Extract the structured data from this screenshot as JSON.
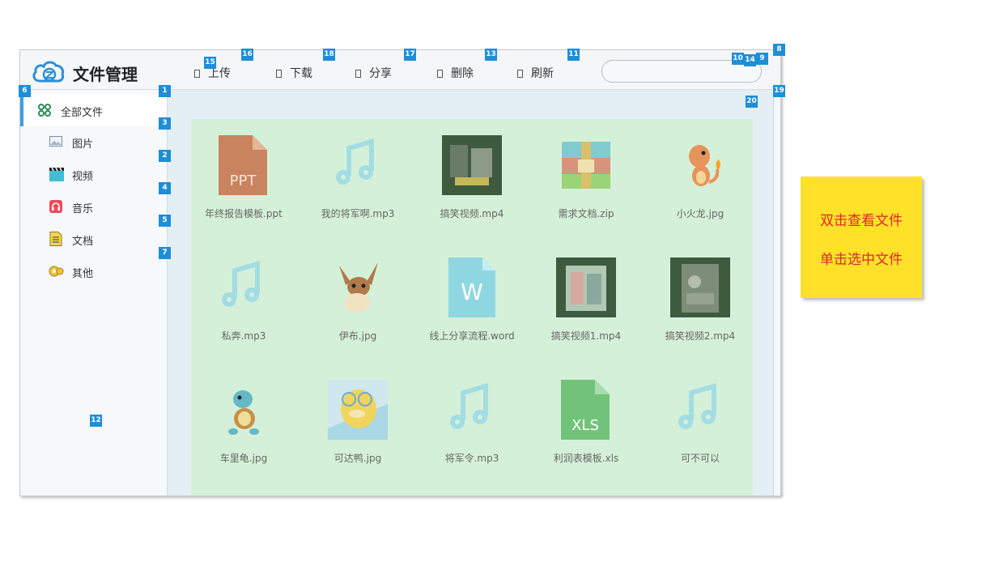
{
  "app": {
    "title": "文件管理"
  },
  "toolbar": {
    "upload": "上传",
    "download": "下载",
    "share": "分享",
    "delete": "删除",
    "refresh": "刷新"
  },
  "search": {
    "value": "",
    "placeholder": ""
  },
  "sidebar": {
    "items": [
      {
        "label": "全部文件",
        "icon": "grid-icon",
        "active": true
      },
      {
        "label": "图片",
        "icon": "image-icon",
        "active": false
      },
      {
        "label": "视频",
        "icon": "clapperboard-icon",
        "active": false
      },
      {
        "label": "音乐",
        "icon": "headphones-icon",
        "active": false
      },
      {
        "label": "文档",
        "icon": "document-icon",
        "active": false
      },
      {
        "label": "其他",
        "icon": "other-icon",
        "active": false
      }
    ]
  },
  "files": [
    {
      "name": "年终报告模板.ppt",
      "type": "ppt"
    },
    {
      "name": "我的将军啊.mp3",
      "type": "music"
    },
    {
      "name": "搞笑视频.mp4",
      "type": "video"
    },
    {
      "name": "需求文档.zip",
      "type": "zip"
    },
    {
      "name": "小火龙.jpg",
      "type": "image"
    },
    {
      "name": "私奔.mp3",
      "type": "music"
    },
    {
      "name": "伊布.jpg",
      "type": "image"
    },
    {
      "name": "线上分享流程.word",
      "type": "word"
    },
    {
      "name": "搞笑视频1.mp4",
      "type": "video"
    },
    {
      "name": "搞笑视频2.mp4",
      "type": "video"
    },
    {
      "name": "车里龟.jpg",
      "type": "image"
    },
    {
      "name": "可达鸭.jpg",
      "type": "image"
    },
    {
      "name": "将军令.mp3",
      "type": "music"
    },
    {
      "name": "利润表模板.xls",
      "type": "xls"
    },
    {
      "name": "可不可以",
      "type": "music"
    }
  ],
  "thumb_text": {
    "ppt": "PPT",
    "word": "W",
    "xls": "XLS"
  },
  "badges": [
    "1",
    "2",
    "3",
    "4",
    "5",
    "6",
    "7",
    "8",
    "9",
    "10",
    "11",
    "12",
    "13",
    "14",
    "15",
    "16",
    "17",
    "18",
    "19",
    "20"
  ],
  "note": {
    "line1": "双击查看文件",
    "line2": "单击选中文件"
  },
  "colors": {
    "accent": "#3d9fe0",
    "badge": "#1e8ed8",
    "panel": "#d5f0d8",
    "note_bg": "#ffe12a",
    "note_text": "#e0262c"
  }
}
